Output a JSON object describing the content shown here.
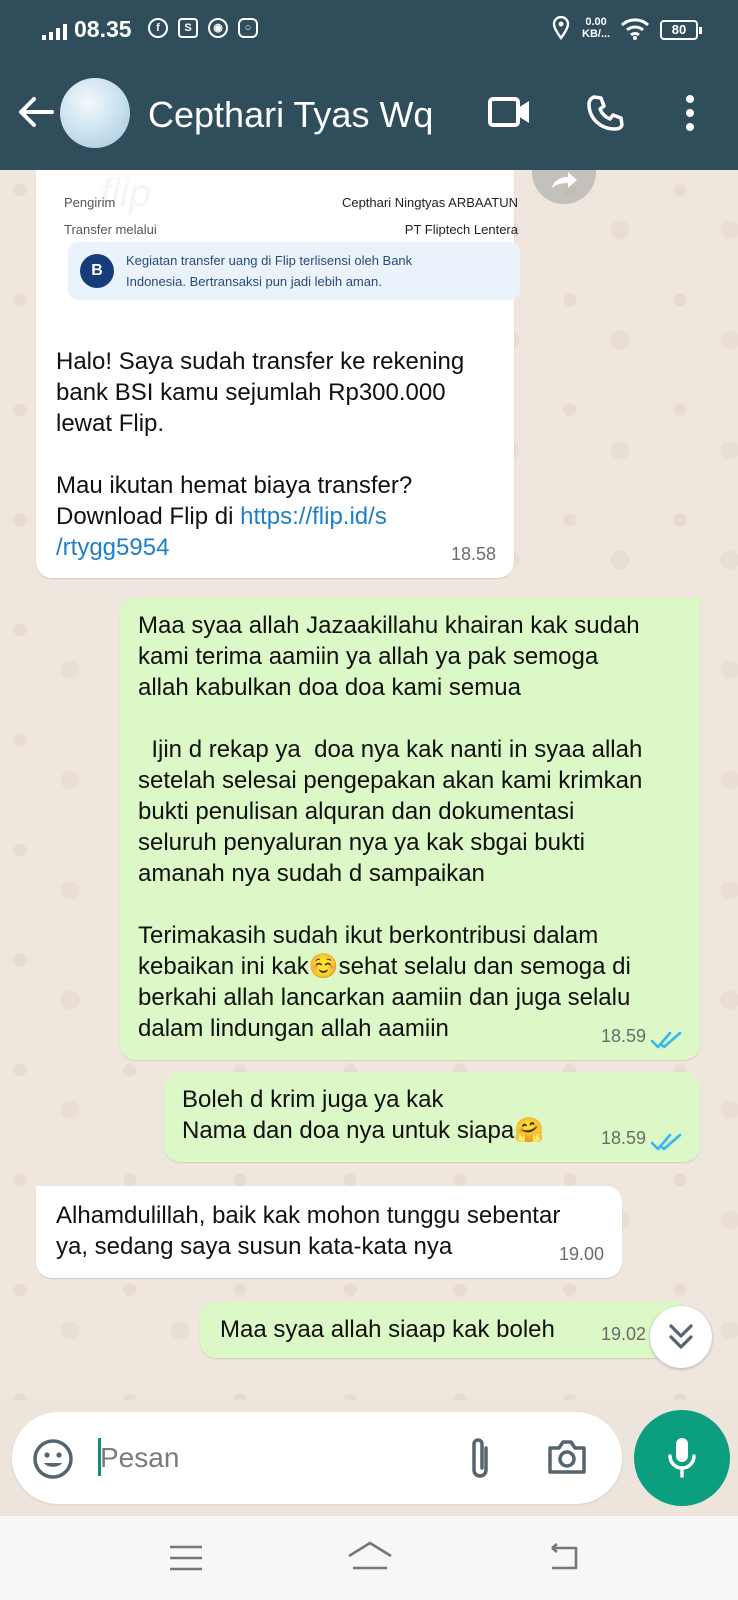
{
  "status_bar": {
    "time": "08.35",
    "net_speed_value": "0.00",
    "net_speed_unit": "KB/...",
    "battery": "80"
  },
  "header": {
    "contact_name": "Cepthari Tyas Wq",
    "icons": [
      "back-arrow-icon",
      "video-call-icon",
      "phone-call-icon",
      "more-vert-icon"
    ]
  },
  "transfer_card": {
    "sender_label": "Pengirim",
    "sender_value": "Cepthari Ningtyas ARBAATUN",
    "via_label": "Transfer melalui",
    "via_value": "PT Fliptech Lentera",
    "notice_line1": "Kegiatan transfer uang di Flip terlisensi oleh Bank",
    "notice_line2": "Indonesia. Bertransaksi pun jadi lebih aman.",
    "watermark": "flip"
  },
  "messages": [
    {
      "direction": "in",
      "text": "Halo! Saya sudah transfer ke rekening\nbank BSI kamu sejumlah Rp300.000\nlewat Flip.\n\nMau ikutan hemat biaya transfer?\nDownload Flip di ",
      "link_line1": "https://flip.id/s",
      "link_line2": "/rtygg5954",
      "time": "18.58"
    },
    {
      "direction": "out",
      "text": "Maa syaa allah Jazaakillahu khairan kak sudah\nkami terima aamiin ya allah ya pak semoga\nallah kabulkan doa doa kami semua\n\n  Ijin d rekap ya  doa nya kak nanti in syaa allah\nsetelah selesai pengepakan akan kami krimkan\nbukti penulisan alquran dan dokumentasi\nseluruh penyaluran nya ya kak sbgai bukti\namanah nya sudah d sampaikan\n\nTerimakasih sudah ikut berkontribusi dalam\nkebaikan ini kak☺️sehat selalu dan semoga di\nberkahi allah lancarkan aamiin dan juga selalu\ndalam lindungan allah aamiin",
      "time": "18.59",
      "status": "read"
    },
    {
      "direction": "out",
      "text": "Boleh d krim juga ya kak\nNama dan doa nya untuk siapa🤗",
      "time": "18.59",
      "status": "read"
    },
    {
      "direction": "in",
      "text": "Alhamdulillah, baik kak mohon tunggu sebentar\nya, sedang saya susun kata-kata nya",
      "time": "19.00"
    },
    {
      "direction": "out",
      "text": "Maa syaa allah siaap kak boleh",
      "time": "19.02"
    }
  ],
  "composer": {
    "placeholder": "Pesan",
    "icons": [
      "emoji-icon",
      "attach-icon",
      "camera-icon",
      "mic-icon"
    ]
  },
  "colors": {
    "header": "#2f4d5b",
    "outgoing_bubble": "#dcf8c6",
    "incoming_bubble": "#ffffff",
    "accent": "#0b9e7f",
    "read_ticks": "#34b7f1",
    "link": "#1e7fc6"
  }
}
